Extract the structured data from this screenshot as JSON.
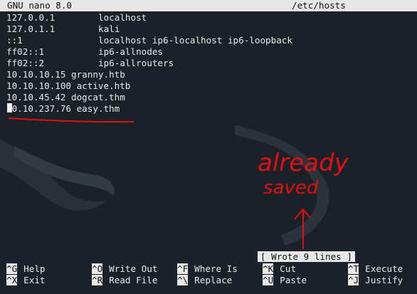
{
  "titlebar": {
    "app": "GNU nano 8.0",
    "file": "/etc/hosts"
  },
  "hosts": [
    {
      "ip": "127.0.0.1",
      "names": "localhost"
    },
    {
      "ip": "127.0.1.1",
      "names": "kali"
    },
    {
      "ip": "::1",
      "names": "localhost ip6-localhost ip6-loopback"
    },
    {
      "ip": "ff02::1",
      "names": "ip6-allnodes"
    },
    {
      "ip": "ff02::2",
      "names": "ip6-allrouters"
    },
    {
      "line": "10.10.10.15 granny.htb"
    },
    {
      "line": "10.10.10.100 active.htb"
    },
    {
      "line": "10.10.45.42 dogcat.thm"
    },
    {
      "line": "10.10.237.76 easy.thm"
    }
  ],
  "status": "[ Wrote 9 lines ]",
  "shortcuts": [
    {
      "key": "^G",
      "label": "Help"
    },
    {
      "key": "^X",
      "label": "Exit"
    },
    {
      "key": "^O",
      "label": "Write Out"
    },
    {
      "key": "^R",
      "label": "Read File"
    },
    {
      "key": "^F",
      "label": "Where Is"
    },
    {
      "key": "^\\",
      "label": "Replace"
    },
    {
      "key": "^K",
      "label": "Cut"
    },
    {
      "key": "^U",
      "label": "Paste"
    },
    {
      "key": "^T",
      "label": "Execute"
    },
    {
      "key": "^J",
      "label": "Justify"
    }
  ],
  "annotation": {
    "line1": "already",
    "line2": "saved",
    "color": "#e01010"
  }
}
